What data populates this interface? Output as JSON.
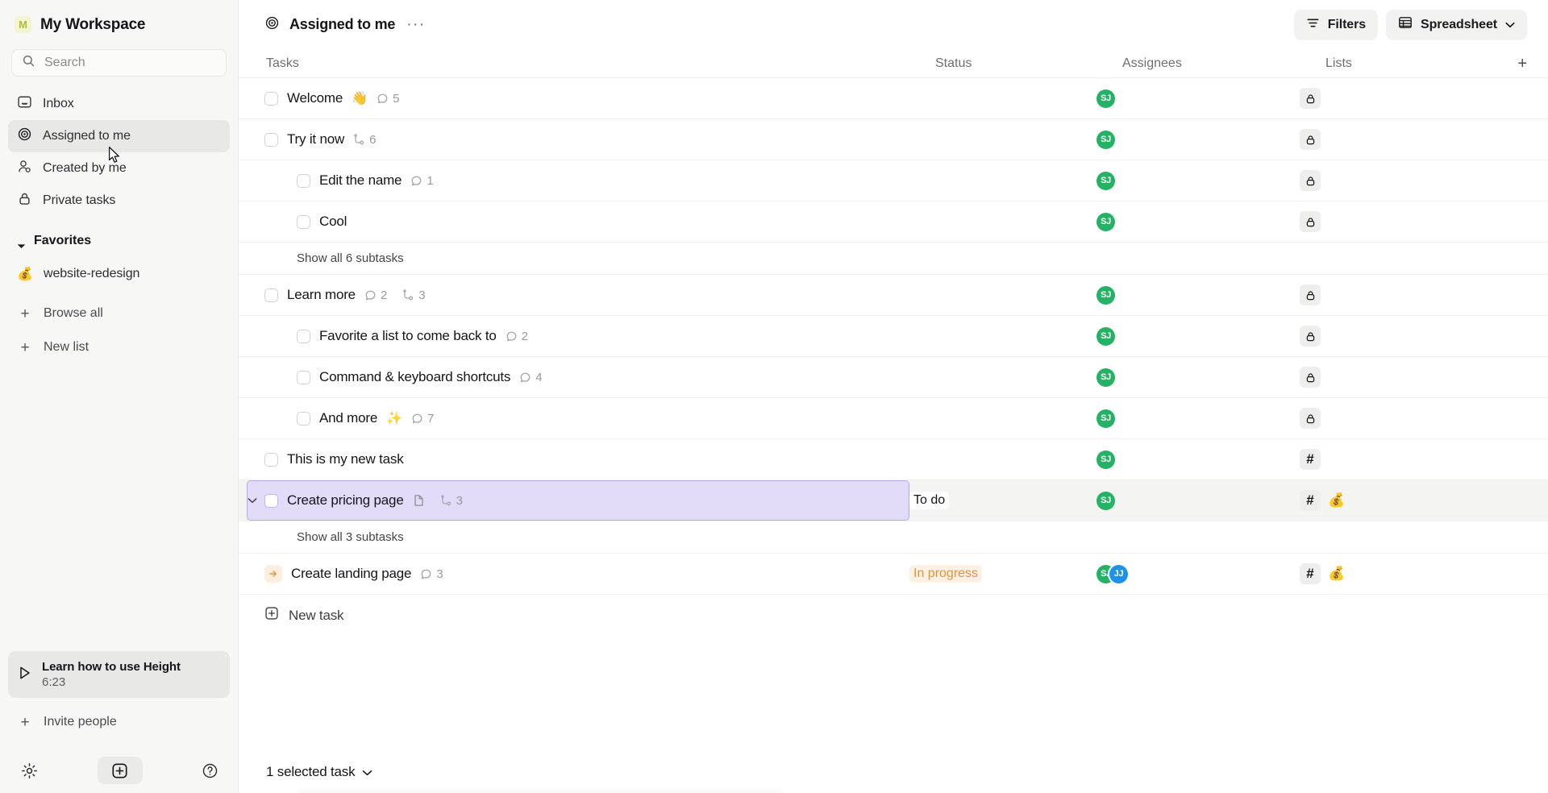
{
  "sidebar": {
    "workspace": {
      "avatar_letter": "M",
      "name": "My Workspace",
      "avatar_color": "#f2f5cd"
    },
    "search": {
      "placeholder": "Search"
    },
    "nav_items": [
      {
        "label": "Inbox",
        "icon": "inbox-icon",
        "active": false
      },
      {
        "label": "Assigned to me",
        "icon": "target-icon",
        "active": true
      },
      {
        "label": "Created by me",
        "icon": "person-icon",
        "active": false
      },
      {
        "label": "Private tasks",
        "icon": "lock-icon",
        "active": false
      }
    ],
    "favorites": {
      "title": "Favorites",
      "items": [
        {
          "label": "website-redesign",
          "emoji": "💰"
        }
      ]
    },
    "add_actions": [
      {
        "label": "Browse all",
        "icon": "plus-icon"
      },
      {
        "label": "New list",
        "icon": "plus-icon"
      }
    ],
    "learn_card": {
      "title": "Learn how to use Height",
      "duration": "6:23",
      "icon": "play-icon"
    },
    "invite": {
      "label": "Invite people",
      "icon": "plus-icon"
    },
    "footer": [
      {
        "name": "settings-gear-icon"
      },
      {
        "name": "new-item-plus-icon"
      },
      {
        "name": "help-question-icon"
      }
    ]
  },
  "topbar": {
    "view_icon": "target-icon",
    "view_title": "Assigned to me",
    "overflow": "···",
    "filters_label": "Filters",
    "view_mode_label": "Spreadsheet"
  },
  "columns": {
    "tasks": "Tasks",
    "status": "Status",
    "assignees": "Assignees",
    "lists": "Lists",
    "add_column": "+"
  },
  "rows": [
    {
      "kind": "task",
      "indent": 0,
      "label": "Welcome",
      "emoji": "👋",
      "comments": "5",
      "subtasks": null,
      "doc": false,
      "status": "",
      "assignees": [
        {
          "initials": "SJ",
          "color": "#24b365"
        }
      ],
      "lists": [
        {
          "type": "lock"
        }
      ],
      "selected": false,
      "expanded": false
    },
    {
      "kind": "task",
      "indent": 0,
      "label": "Try it now",
      "emoji": "",
      "comments": null,
      "subtasks": "6",
      "doc": false,
      "status": "",
      "assignees": [
        {
          "initials": "SJ",
          "color": "#24b365"
        }
      ],
      "lists": [
        {
          "type": "lock"
        }
      ],
      "selected": false,
      "expanded": true
    },
    {
      "kind": "task",
      "indent": 1,
      "label": "Edit the name",
      "emoji": "",
      "comments": "1",
      "subtasks": null,
      "doc": false,
      "status": "",
      "assignees": [
        {
          "initials": "SJ",
          "color": "#24b365"
        }
      ],
      "lists": [
        {
          "type": "lock"
        }
      ],
      "selected": false,
      "expanded": false
    },
    {
      "kind": "task",
      "indent": 1,
      "label": "Cool",
      "emoji": "",
      "comments": null,
      "subtasks": null,
      "doc": false,
      "status": "",
      "assignees": [
        {
          "initials": "SJ",
          "color": "#24b365"
        }
      ],
      "lists": [
        {
          "type": "lock"
        }
      ],
      "selected": false,
      "expanded": false
    },
    {
      "kind": "showall",
      "label": "Show all 6 subtasks"
    },
    {
      "kind": "task",
      "indent": 0,
      "label": "Learn more",
      "emoji": "",
      "comments": "2",
      "subtasks": "3",
      "doc": false,
      "status": "",
      "assignees": [
        {
          "initials": "SJ",
          "color": "#24b365"
        }
      ],
      "lists": [
        {
          "type": "lock"
        }
      ],
      "selected": false,
      "expanded": false
    },
    {
      "kind": "task",
      "indent": 1,
      "label": "Favorite a list to come back to",
      "emoji": "",
      "comments": "2",
      "subtasks": null,
      "doc": false,
      "status": "",
      "assignees": [
        {
          "initials": "SJ",
          "color": "#24b365"
        }
      ],
      "lists": [
        {
          "type": "lock"
        }
      ],
      "selected": false,
      "expanded": false
    },
    {
      "kind": "task",
      "indent": 1,
      "label": "Command & keyboard shortcuts",
      "emoji": "",
      "comments": "4",
      "subtasks": null,
      "doc": false,
      "status": "",
      "assignees": [
        {
          "initials": "SJ",
          "color": "#24b365"
        }
      ],
      "lists": [
        {
          "type": "lock"
        }
      ],
      "selected": false,
      "expanded": false
    },
    {
      "kind": "task",
      "indent": 1,
      "label": "And more",
      "emoji": "✨",
      "comments": "7",
      "subtasks": null,
      "doc": false,
      "status": "",
      "assignees": [
        {
          "initials": "SJ",
          "color": "#24b365"
        }
      ],
      "lists": [
        {
          "type": "lock"
        }
      ],
      "selected": false,
      "expanded": false
    },
    {
      "kind": "task",
      "indent": 0,
      "label": "This is my new task",
      "emoji": "",
      "comments": null,
      "subtasks": null,
      "doc": false,
      "status": "",
      "assignees": [
        {
          "initials": "SJ",
          "color": "#24b365"
        }
      ],
      "lists": [
        {
          "type": "hash"
        }
      ],
      "selected": false,
      "expanded": false
    },
    {
      "kind": "task",
      "indent": 0,
      "label": "Create pricing page",
      "emoji": "",
      "comments": null,
      "subtasks": "3",
      "doc": true,
      "status": "To do",
      "status_style": "todo",
      "assignees": [
        {
          "initials": "SJ",
          "color": "#24b365"
        }
      ],
      "lists": [
        {
          "type": "hash"
        },
        {
          "type": "globe",
          "emoji": "💰"
        }
      ],
      "selected": true,
      "expanded": true
    },
    {
      "kind": "showall",
      "label": "Show all 3 subtasks"
    },
    {
      "kind": "task",
      "indent": 0,
      "label": "Create landing page",
      "emoji": "",
      "comments": "3",
      "subtasks": null,
      "doc": false,
      "lead_icon": "arrow-right-badge",
      "status": "In progress",
      "status_style": "progress",
      "assignees": [
        {
          "initials": "SJ",
          "color": "#24b365"
        },
        {
          "initials": "JJ",
          "color": "#1f92e8"
        }
      ],
      "lists": [
        {
          "type": "hash"
        },
        {
          "type": "globe",
          "emoji": "💰"
        }
      ],
      "selected": false,
      "expanded": false
    }
  ],
  "new_task": {
    "label": "New task",
    "icon": "plus-box-icon"
  },
  "footer": {
    "selection_label": "1 selected task"
  },
  "colors": {
    "selection_fill": "#e3dcf8",
    "selection_border": "#b9a8ee",
    "avatar_green": "#24b365",
    "avatar_blue": "#1f92e8",
    "status_progress": "#e0943f",
    "sidebar_bg": "#f7f7f6"
  }
}
